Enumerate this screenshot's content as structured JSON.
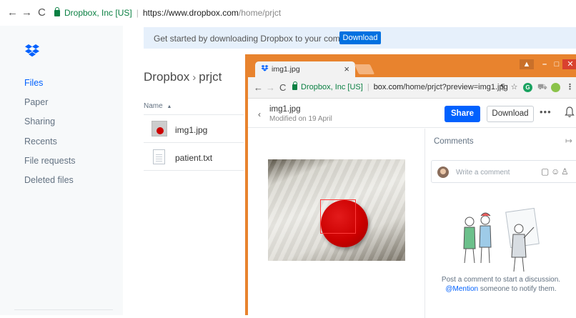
{
  "outer_browser": {
    "site_label": "Dropbox, Inc [US]",
    "url_host": "https://www.dropbox.com",
    "url_path": "/home/prjct"
  },
  "sidebar": {
    "items": [
      {
        "label": "Files",
        "active": true
      },
      {
        "label": "Paper"
      },
      {
        "label": "Sharing"
      },
      {
        "label": "Recents"
      },
      {
        "label": "File requests"
      },
      {
        "label": "Deleted files"
      }
    ]
  },
  "banner": {
    "text": "Get started by downloading Dropbox to your computer.",
    "button": "Download"
  },
  "main": {
    "breadcrumb_root": "Dropbox",
    "breadcrumb_current": "prjct",
    "column_name": "Name",
    "files": [
      {
        "name": "img1.jpg",
        "icon": "image-thumbnail"
      },
      {
        "name": "patient.txt",
        "icon": "text-file-icon"
      }
    ]
  },
  "popup": {
    "tab_title": "img1.jpg",
    "site_label": "Dropbox, Inc [US]",
    "url_host": "box.com",
    "url_path": "/home/prjct?preview=img1.jpg",
    "file_title": "img1.jpg",
    "file_modified": "Modified on 19 April",
    "share_label": "Share",
    "download_label": "Download",
    "comments_title": "Comments",
    "comment_placeholder": "Write a comment",
    "empty_line1": "Post a comment to start a discussion.",
    "mention": "@Mention",
    "empty_line2": " someone to notify them."
  },
  "colors": {
    "dropbox_blue": "#0061fe",
    "window_frame": "#e8832e",
    "banner_bg": "#e6f0fb",
    "secure_green": "#0b8043"
  }
}
